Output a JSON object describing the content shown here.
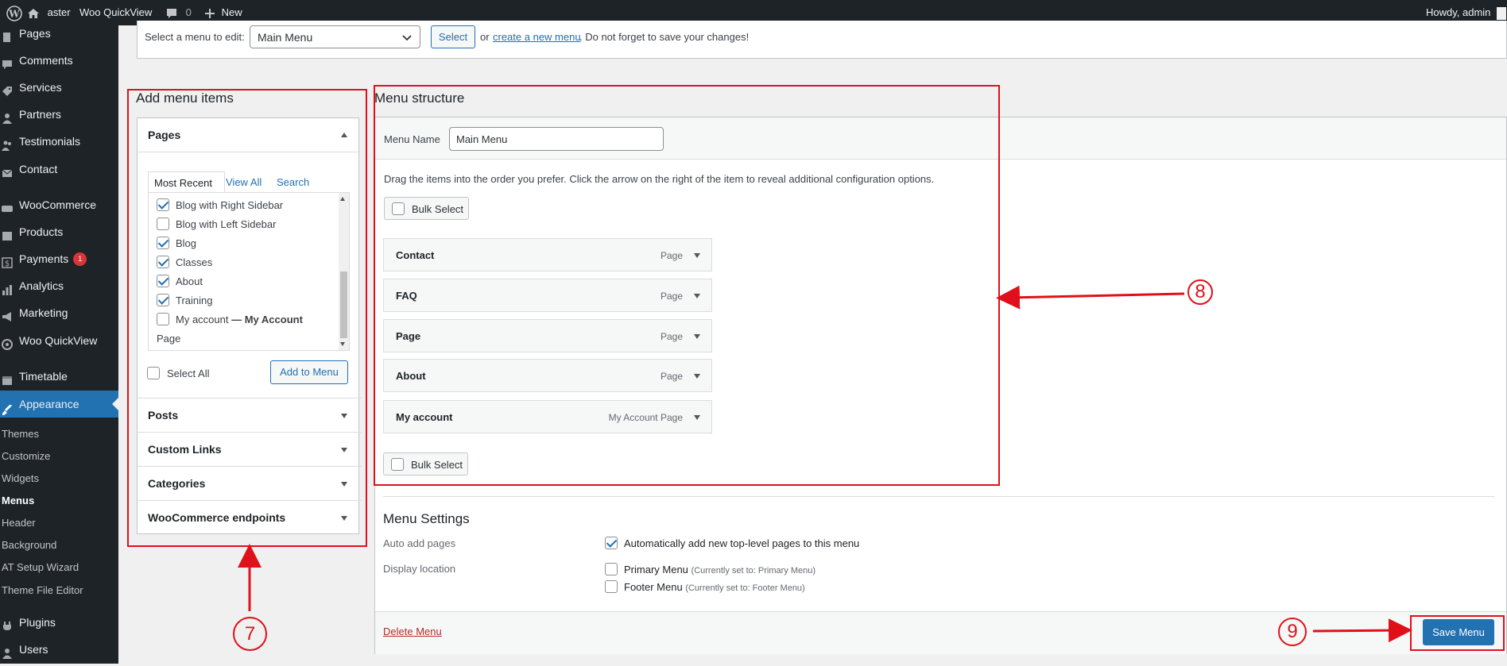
{
  "admin_bar": {
    "site_name": "aster",
    "plugin_link": "Woo QuickView",
    "comments_count": "0",
    "new_label": "New",
    "howdy": "Howdy, admin"
  },
  "sidebar": {
    "items": [
      {
        "label": "Pages",
        "icon": "pages-icon"
      },
      {
        "label": "Comments",
        "icon": "comments-icon"
      },
      {
        "label": "Services",
        "icon": "tag-icon"
      },
      {
        "label": "Partners",
        "icon": "user-icon"
      },
      {
        "label": "Testimonials",
        "icon": "users-icon"
      },
      {
        "label": "Contact",
        "icon": "mail-icon"
      },
      {
        "label": "WooCommerce",
        "icon": "woo-icon"
      },
      {
        "label": "Products",
        "icon": "archive-icon"
      },
      {
        "label": "Payments",
        "icon": "dollar-icon",
        "badge": "1"
      },
      {
        "label": "Analytics",
        "icon": "chart-icon"
      },
      {
        "label": "Marketing",
        "icon": "megaphone-icon"
      },
      {
        "label": "Woo QuickView",
        "icon": "eye-icon"
      },
      {
        "label": "Timetable",
        "icon": "calendar-icon"
      },
      {
        "label": "Appearance",
        "icon": "brush-icon"
      },
      {
        "label": "Plugins",
        "icon": "plugin-icon"
      },
      {
        "label": "Users",
        "icon": "user-icon"
      }
    ],
    "submenu": [
      "Themes",
      "Customize",
      "Widgets",
      "Menus",
      "Header",
      "Background",
      "AT Setup Wizard",
      "Theme File Editor"
    ]
  },
  "top_bar": {
    "select_label": "Select a menu to edit:",
    "selected_menu": "Main Menu",
    "select_button": "Select",
    "or_text": "or",
    "create_link": "create a new menu",
    "reminder": ". Do not forget to save your changes!"
  },
  "add_menu_items": {
    "heading": "Add menu items",
    "pages_section": "Pages",
    "tabs": [
      "Most Recent",
      "View All",
      "Search"
    ],
    "page_items": [
      {
        "label": "Blog with Right Sidebar",
        "checked": true
      },
      {
        "label": "Blog with Left Sidebar",
        "checked": false
      },
      {
        "label": "Blog",
        "checked": true
      },
      {
        "label": "Classes",
        "checked": true
      },
      {
        "label": "About",
        "checked": true
      },
      {
        "label": "Training",
        "checked": true
      },
      {
        "label": "My account",
        "suffix": "— My Account",
        "checked": false
      }
    ],
    "partial_item": "Page",
    "select_all": "Select All",
    "add_button": "Add to Menu",
    "other_sections": [
      "Posts",
      "Custom Links",
      "Categories",
      "WooCommerce endpoints"
    ]
  },
  "menu_structure": {
    "heading": "Menu structure",
    "name_label": "Menu Name",
    "name_value": "Main Menu",
    "instructions": "Drag the items into the order you prefer. Click the arrow on the right of the item to reveal additional configuration options.",
    "bulk_select": "Bulk Select",
    "items": [
      {
        "title": "Contact",
        "type": "Page"
      },
      {
        "title": "FAQ",
        "type": "Page"
      },
      {
        "title": "Page",
        "type": "Page"
      },
      {
        "title": "About",
        "type": "Page"
      },
      {
        "title": "My account",
        "type": "My Account Page"
      }
    ]
  },
  "menu_settings": {
    "heading": "Menu Settings",
    "auto_add_label": "Auto add pages",
    "auto_add_text": "Automatically add new top-level pages to this menu",
    "auto_add_checked": true,
    "display_label": "Display location",
    "locations": [
      {
        "label": "Primary Menu",
        "note": "(Currently set to: Primary Menu)",
        "checked": false
      },
      {
        "label": "Footer Menu",
        "note": "(Currently set to: Footer Menu)",
        "checked": false
      }
    ]
  },
  "footer": {
    "delete_link": "Delete Menu",
    "save_button": "Save Menu"
  },
  "annotations": [
    "7",
    "8",
    "9"
  ],
  "colors": {
    "accent": "#2271b1",
    "annotation": "#e0101a",
    "sidebar_bg": "#1d2327"
  }
}
